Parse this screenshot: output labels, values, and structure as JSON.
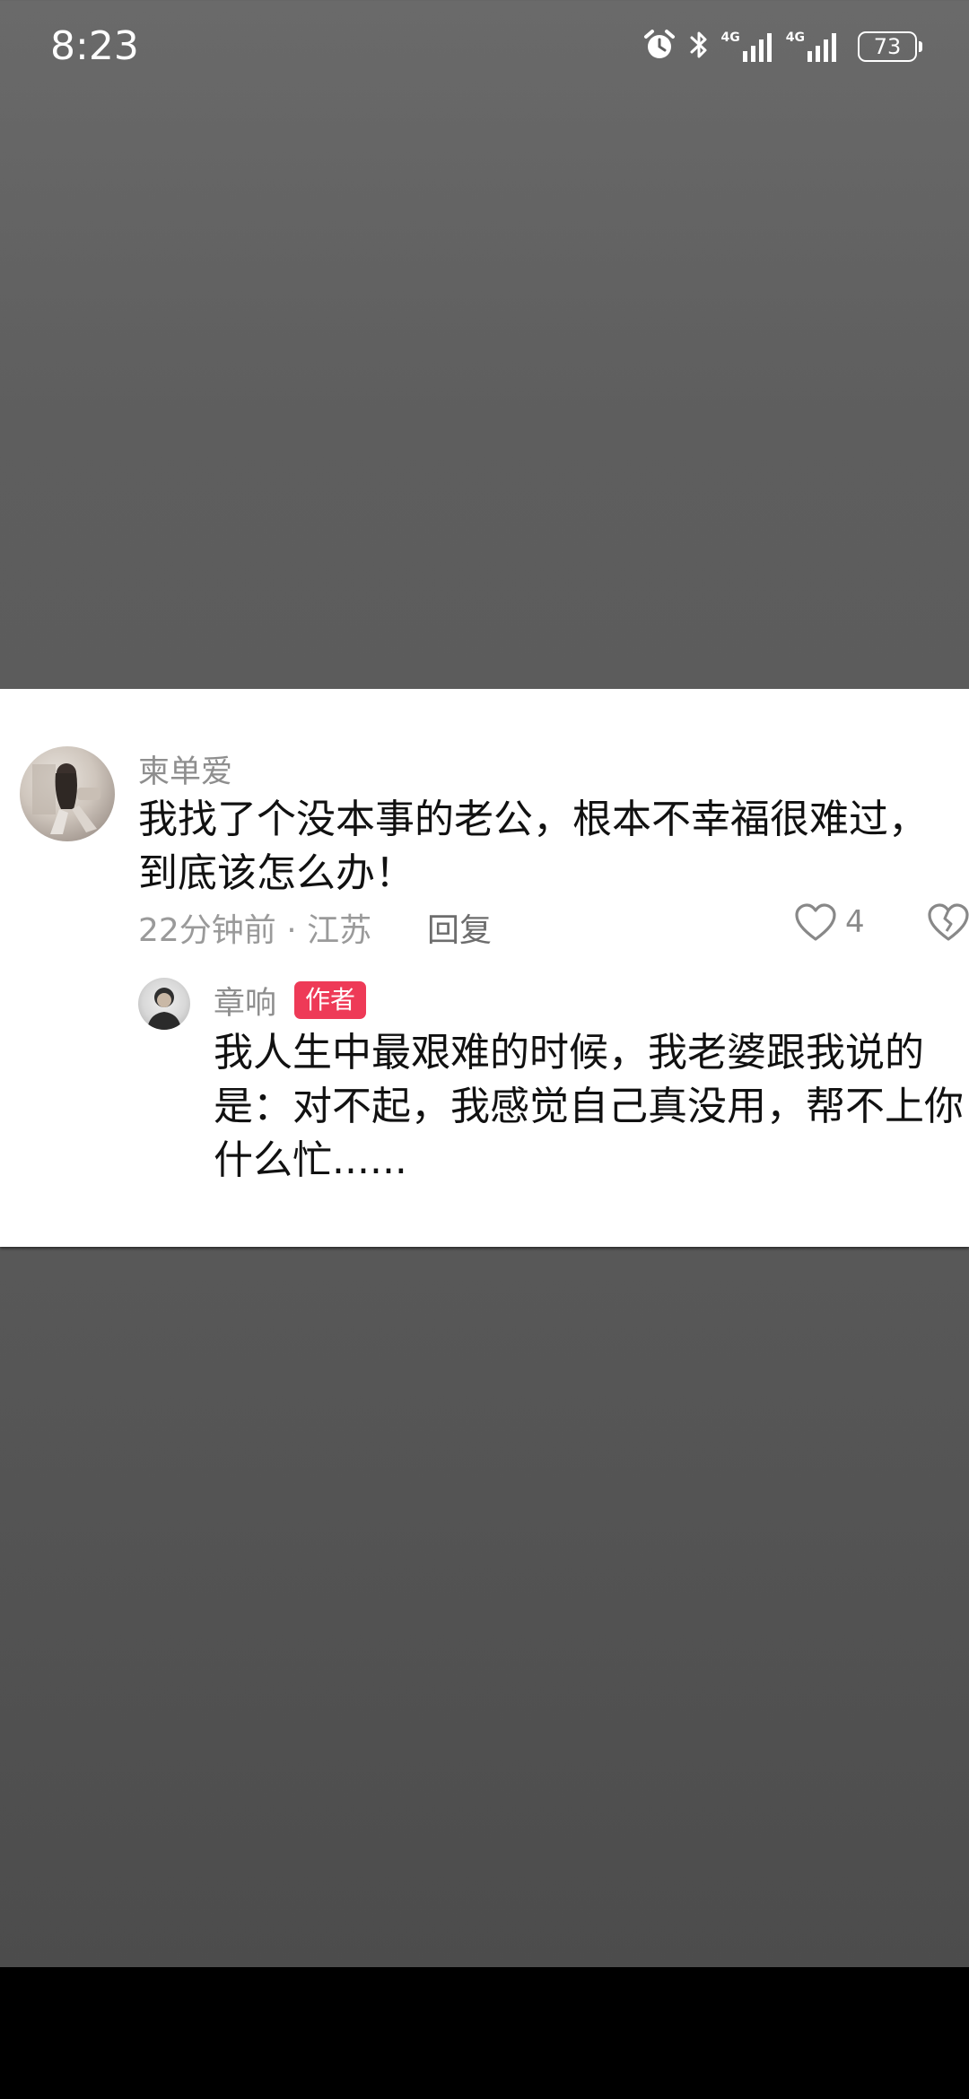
{
  "status_bar": {
    "time": "8:23",
    "network_1": "4G",
    "network_2": "4G",
    "battery": "73"
  },
  "comment": {
    "username": "柬单爱",
    "text": "我找了个没本事的老公，根本不幸福很难过，到底该怎么办！",
    "meta": "22分钟前 · 江苏",
    "reply_label": "回复",
    "like_count": "4"
  },
  "reply": {
    "username": "章响",
    "badge": "作者",
    "text": "我人生中最艰难的时候，我老婆跟我说的是：对不起，我感觉自己真没用，帮不上你什么忙......"
  },
  "colors": {
    "badge": "#ee3a57",
    "background_top": "#6a6a6a",
    "background_bottom": "#4a4a4a"
  }
}
